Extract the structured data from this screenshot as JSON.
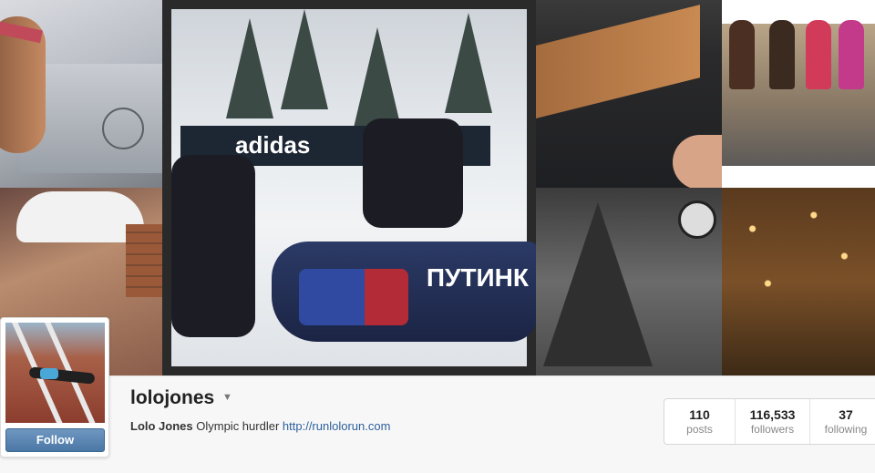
{
  "profile": {
    "username": "lolojones",
    "full_name": "Lolo Jones",
    "bio": "Olympic hurdler",
    "website": "http://runlolorun.com",
    "follow_label": "Follow"
  },
  "stats": [
    {
      "value": "110",
      "label": "posts"
    },
    {
      "value": "116,533",
      "label": "followers"
    },
    {
      "value": "37",
      "label": "following"
    }
  ],
  "photos": {
    "bobsled": {
      "banner_text": "adidas",
      "sled_text": "ПУТИНК"
    }
  },
  "colors": {
    "follow_button": "#4b77a6",
    "link": "#2b5f9c"
  }
}
